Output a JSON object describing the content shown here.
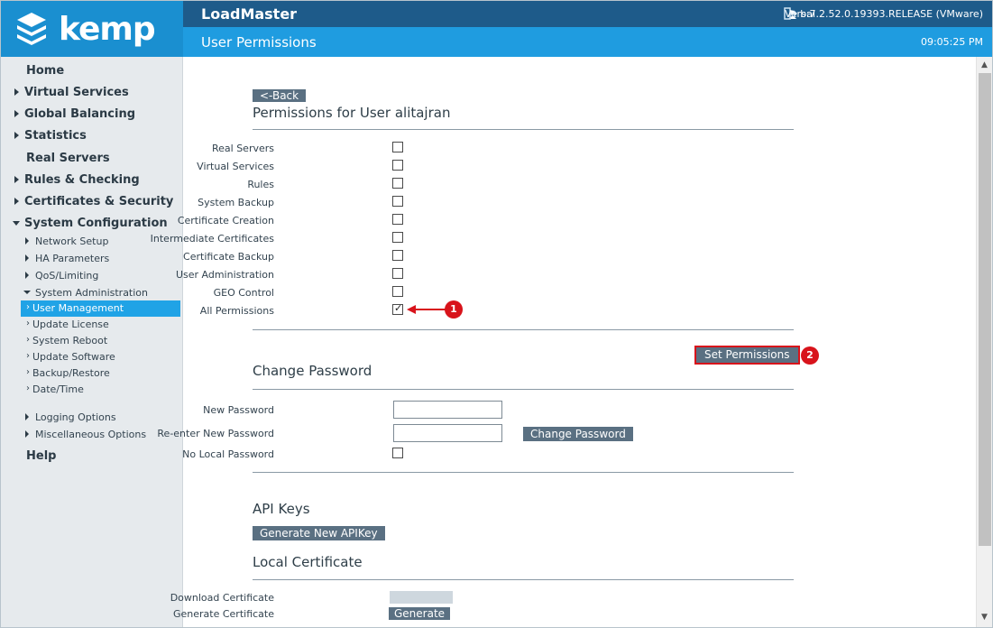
{
  "header": {
    "brand": "kemp",
    "app_title": "LoadMaster",
    "user": "bal",
    "version": "Vers:7.2.52.0.19393.RELEASE (VMware)",
    "page_title": "User Permissions",
    "time": "09:05:25 PM"
  },
  "sidebar": {
    "home": "Home",
    "virtual_services": "Virtual Services",
    "global_balancing": "Global Balancing",
    "statistics": "Statistics",
    "real_servers": "Real Servers",
    "rules_checking": "Rules & Checking",
    "certificates_security": "Certificates & Security",
    "system_configuration": "System Configuration",
    "network_setup": "Network Setup",
    "ha_parameters": "HA Parameters",
    "qos_limiting": "QoS/Limiting",
    "system_administration": "System Administration",
    "user_management": "User Management",
    "update_license": "Update License",
    "system_reboot": "System Reboot",
    "update_software": "Update Software",
    "backup_restore": "Backup/Restore",
    "date_time": "Date/Time",
    "logging_options": "Logging Options",
    "misc_options": "Miscellaneous Options",
    "help": "Help"
  },
  "main": {
    "back_label": "<-Back",
    "permissions_heading": "Permissions for User alitajran",
    "permissions": [
      {
        "label": "Real Servers",
        "checked": false
      },
      {
        "label": "Virtual Services",
        "checked": false
      },
      {
        "label": "Rules",
        "checked": false
      },
      {
        "label": "System Backup",
        "checked": false
      },
      {
        "label": "Certificate Creation",
        "checked": false
      },
      {
        "label": "Intermediate Certificates",
        "checked": false
      },
      {
        "label": "Certificate Backup",
        "checked": false
      },
      {
        "label": "User Administration",
        "checked": false
      },
      {
        "label": "GEO Control",
        "checked": false
      },
      {
        "label": "All Permissions",
        "checked": true
      }
    ],
    "set_permissions_label": "Set Permissions",
    "marker_1": "1",
    "marker_2": "2",
    "change_password_heading": "Change Password",
    "new_password_label": "New Password",
    "reenter_password_label": "Re-enter New Password",
    "no_local_password_label": "No Local Password",
    "change_password_button": "Change Password",
    "api_keys_heading": "API Keys",
    "generate_apikey_label": "Generate New APIKey",
    "local_cert_heading": "Local Certificate",
    "download_cert_label": "Download Certificate",
    "generate_cert_label": "Generate Certificate",
    "generate_button": "Generate"
  },
  "colors": {
    "brand_blue": "#1a8fd0",
    "topbar": "#1e5b8a",
    "subbar": "#1f9ce0",
    "active_nav": "#20a3e6",
    "button": "#5a7082",
    "marker_red": "#d8131b"
  }
}
